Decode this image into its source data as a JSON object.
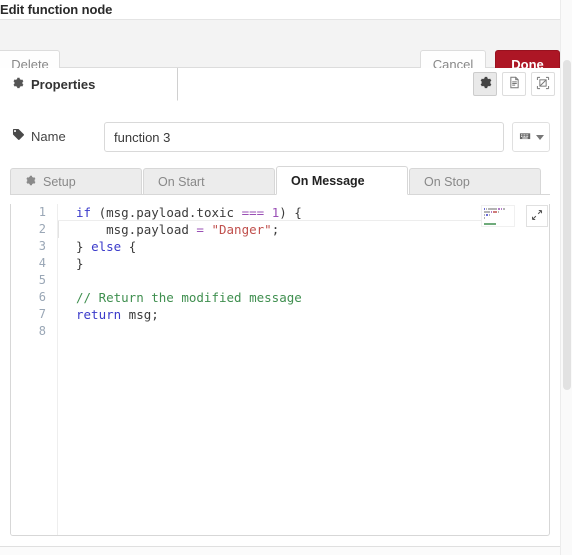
{
  "window": {
    "title": "Edit function node"
  },
  "actions": {
    "delete_label": "Delete",
    "cancel_label": "Cancel",
    "done_label": "Done",
    "done_color": "#ad1625"
  },
  "tabs": {
    "properties_label": "Properties",
    "properties_icon": "gear-icon",
    "toolbar_icons": [
      {
        "name": "gear-icon",
        "active": true
      },
      {
        "name": "description-icon",
        "active": false
      },
      {
        "name": "appearance-icon",
        "active": false
      }
    ]
  },
  "name_field": {
    "label": "Name",
    "icon": "tag-icon",
    "value": "function 3",
    "placeholder": "Name",
    "menu_icon": "keyboard-icon",
    "menu_caret": "chevron-down-icon"
  },
  "subtabs": [
    {
      "label": "Setup",
      "icon": "gear-icon",
      "active": false
    },
    {
      "label": "On Start",
      "icon": null,
      "active": false
    },
    {
      "label": "On Message",
      "icon": null,
      "active": true
    },
    {
      "label": "On Stop",
      "icon": null,
      "active": false
    }
  ],
  "editor": {
    "line_numbers": [
      "1",
      "2",
      "3",
      "4",
      "5",
      "6",
      "7",
      "8"
    ],
    "expand_icon": "expand-arrows-icon",
    "minimap_icon": "code-minimap",
    "lines": [
      {
        "number": "1",
        "tokens": [
          {
            "t": "if",
            "c": "k"
          },
          {
            "t": " (",
            "c": "br"
          },
          {
            "t": "msg.payload.toxic",
            "c": "pl"
          },
          {
            "t": " ",
            "c": "pl"
          },
          {
            "t": "===",
            "c": "op"
          },
          {
            "t": " ",
            "c": "pl"
          },
          {
            "t": "1",
            "c": "num"
          },
          {
            "t": ") {",
            "c": "br"
          }
        ]
      },
      {
        "number": "2",
        "tokens": [
          {
            "t": "    msg.payload ",
            "c": "pl"
          },
          {
            "t": "=",
            "c": "op"
          },
          {
            "t": " ",
            "c": "pl"
          },
          {
            "t": "\"Danger\"",
            "c": "st"
          },
          {
            "t": ";",
            "c": "pl"
          }
        ]
      },
      {
        "number": "3",
        "tokens": [
          {
            "t": "} ",
            "c": "br"
          },
          {
            "t": "else",
            "c": "k"
          },
          {
            "t": " {",
            "c": "br"
          }
        ]
      },
      {
        "number": "4",
        "tokens": [
          {
            "t": "}",
            "c": "br"
          }
        ]
      },
      {
        "number": "5",
        "tokens": [
          {
            "t": "",
            "c": "pl"
          }
        ]
      },
      {
        "number": "6",
        "tokens": [
          {
            "t": "// Return the modified message",
            "c": "cm"
          }
        ]
      },
      {
        "number": "7",
        "tokens": [
          {
            "t": "return",
            "c": "k"
          },
          {
            "t": " msg;",
            "c": "pl"
          }
        ]
      },
      {
        "number": "8",
        "tokens": [
          {
            "t": "",
            "c": "pl"
          }
        ]
      }
    ]
  },
  "colors": {
    "accent_red": "#ad1625",
    "keyword": "#3a3aca",
    "string": "#c0504d",
    "comment": "#3f8f4f",
    "operator": "#9a4fb5",
    "gutter": "#9aa7b6"
  }
}
